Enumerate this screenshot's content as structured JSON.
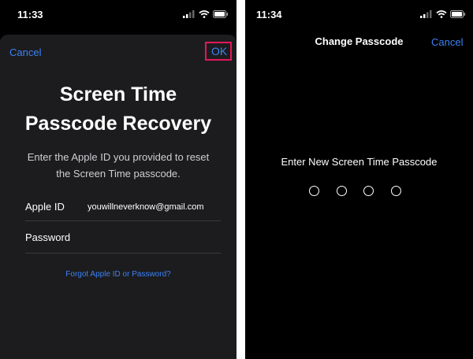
{
  "left_screen": {
    "status_time": "11:33",
    "cancel_label": "Cancel",
    "ok_label": "OK",
    "title_line1": "Screen Time",
    "title_line2": "Passcode Recovery",
    "subtitle_line1": "Enter the Apple ID you provided to reset",
    "subtitle_line2": "the Screen Time passcode.",
    "apple_id_label": "Apple ID",
    "apple_id_value": "youwillneverknow@gmail.com",
    "password_label": "Password",
    "forgot_link": "Forgot Apple ID or Password?"
  },
  "right_screen": {
    "status_time": "11:34",
    "nav_title": "Change Passcode",
    "cancel_label": "Cancel",
    "prompt": "Enter New Screen Time Passcode",
    "passcode_digits_entered": 0,
    "passcode_length": 4
  },
  "colors": {
    "accent": "#3b82f6",
    "highlight_box": "#e3175a",
    "sheet_background": "#1c1c1e",
    "background": "#000000"
  }
}
